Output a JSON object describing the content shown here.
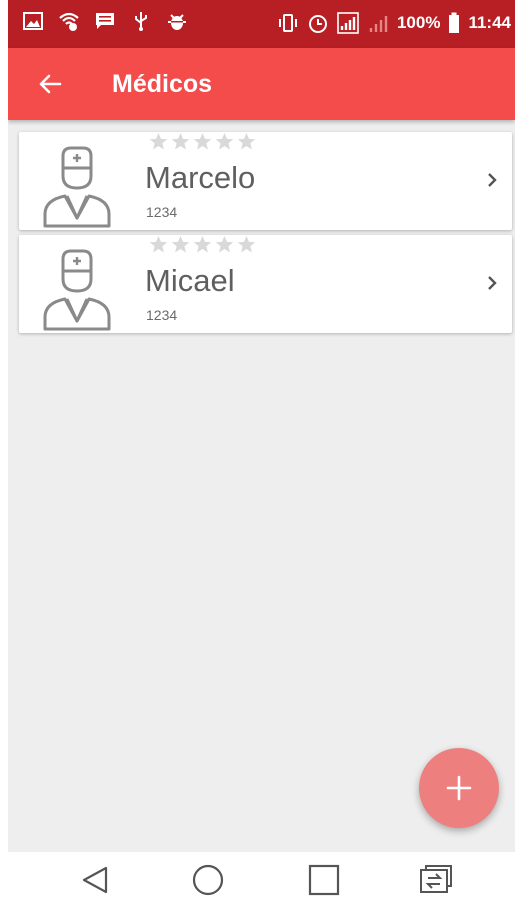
{
  "status_bar": {
    "battery": "100%",
    "time": "11:44",
    "network_label": "4G"
  },
  "app_bar": {
    "title": "Médicos",
    "background": "#f44b4b"
  },
  "doctors": [
    {
      "name": "Marcelo",
      "code": "1234",
      "rating": 0
    },
    {
      "name": "Micael",
      "code": "1234",
      "rating": 0
    }
  ],
  "fab": {
    "label": "+"
  },
  "colors": {
    "status_bar": "#b71f24",
    "fab": "#ed7f7f",
    "list_bg": "#eeeeee"
  }
}
